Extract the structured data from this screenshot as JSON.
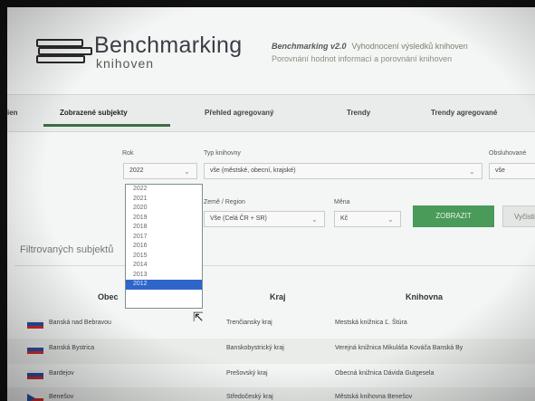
{
  "header": {
    "title": "Benchmarking",
    "subtitle": "knihoven",
    "product": "Benchmarking v2.0",
    "desc_line1": "Vyhodnocení výsledků knihoven",
    "desc_line2": "Porovnání hodnot informací a porovnání knihoven"
  },
  "nav": {
    "items": [
      {
        "label": "ien"
      },
      {
        "label": "Zobrazené subjekty"
      },
      {
        "label": "Přehled agregovaný"
      },
      {
        "label": "Trendy"
      },
      {
        "label": "Trendy agregované"
      }
    ]
  },
  "filters": {
    "rok_label": "Rok",
    "rok_value": "2022",
    "typ_label": "Typ knihovny",
    "typ_value": "vše (městské, obecní, krajské)",
    "oblast_label": "Obsluhované",
    "oblast_value": "vše",
    "zeme_label": "Země / Region",
    "zeme_value": "Vše (Celá ČR + SR)",
    "mena_label": "Měna",
    "mena_value": "Kč",
    "apply_label": "ZOBRAZIT",
    "reset_label": "Vyčistit"
  },
  "dropdown": {
    "years": [
      "2022",
      "2021",
      "2020",
      "2019",
      "2018",
      "2017",
      "2016",
      "2015",
      "2014",
      "2013",
      "2012"
    ],
    "selected": "2012"
  },
  "filtered_label": "Filtrovaných subjektů",
  "table": {
    "headers": {
      "obec": "Obec",
      "kraj": "Kraj",
      "knihovna": "Knihovna"
    },
    "rows": [
      {
        "obec": "Banská nad Bebravou",
        "kraj": "Trenčiansky kraj",
        "knihovna": "Mestská knižnica Ľ. Štúra",
        "flag": "sk"
      },
      {
        "obec": "Banská Bystrica",
        "kraj": "Banskobystrický kraj",
        "knihovna": "Verejná knižnica Mikuláša Kováča Banská By",
        "flag": "sk"
      },
      {
        "obec": "Bardejov",
        "kraj": "Prešovský kraj",
        "knihovna": "Obecná knižnica Dávida Gutgesela",
        "flag": "sk"
      },
      {
        "obec": "Benešov",
        "kraj": "Středočeský kraj",
        "knihovna": "Městská knihovna Benešov",
        "flag": "cz"
      }
    ]
  },
  "colors": {
    "accent": "#3c6d48",
    "button_green": "#4a9a5a",
    "dropdown_selected": "#2f65c8"
  }
}
